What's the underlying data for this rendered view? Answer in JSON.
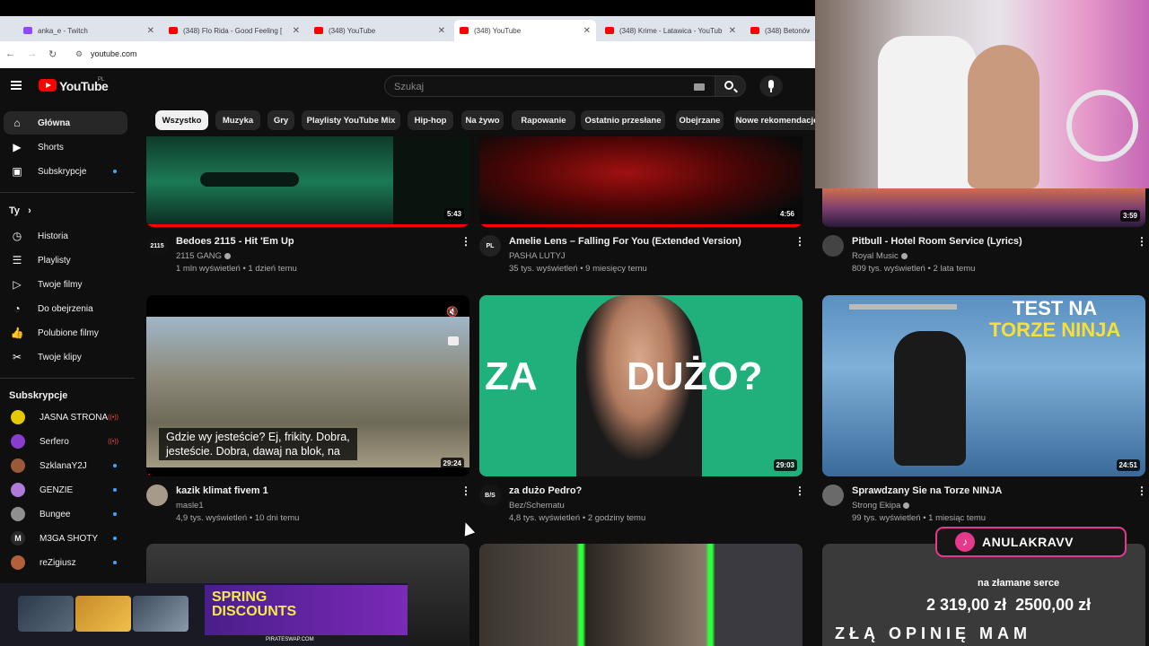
{
  "browser": {
    "tabs": [
      {
        "title": "anka_e - Twitch",
        "icon": "twitch-icon"
      },
      {
        "title": "(348) Flo Rida - Good Feeling [",
        "icon": "youtube-icon"
      },
      {
        "title": "(348) YouTube",
        "icon": "youtube-icon"
      },
      {
        "title": "(348) YouTube",
        "icon": "youtube-icon",
        "active": true
      },
      {
        "title": "(348) Krime - Latawica - YouTub",
        "icon": "youtube-icon"
      },
      {
        "title": "(348) Betonów",
        "icon": "youtube-icon"
      }
    ],
    "url": "youtube.com"
  },
  "header": {
    "logo_text": "YouTube",
    "country": "PL",
    "search_placeholder": "Szukaj"
  },
  "sidebar": {
    "main": [
      {
        "label": "Główna",
        "icon": "home-icon",
        "active": true
      },
      {
        "label": "Shorts",
        "icon": "shorts-icon"
      },
      {
        "label": "Subskrypcje",
        "icon": "subscriptions-icon",
        "dot": true
      }
    ],
    "you_heading": "Ty",
    "you": [
      {
        "label": "Historia",
        "icon": "history-icon"
      },
      {
        "label": "Playlisty",
        "icon": "playlist-icon"
      },
      {
        "label": "Twoje filmy",
        "icon": "your-videos-icon"
      },
      {
        "label": "Do obejrzenia",
        "icon": "watch-later-icon"
      },
      {
        "label": "Polubione filmy",
        "icon": "like-icon"
      },
      {
        "label": "Twoje klipy",
        "icon": "clips-icon"
      }
    ],
    "subs_heading": "Subskrypcje",
    "subs": [
      {
        "label": "JASNA STRONA",
        "color": "#e6c800",
        "live": true
      },
      {
        "label": "Serfero",
        "color": "#8a3ccf",
        "live": true
      },
      {
        "label": "SzklanaY2J",
        "color": "#9a5a3a",
        "dot": true
      },
      {
        "label": "GENZIE",
        "color": "#b07ad9",
        "dot": true
      },
      {
        "label": "Bungee",
        "color": "#8f8f8f",
        "dot": true
      },
      {
        "label": "M3GA SHOTY",
        "color": "#2a2a2a",
        "dot": true
      },
      {
        "label": "reZigiusz",
        "color": "#b0603a",
        "dot": true
      }
    ]
  },
  "chips": [
    "Wszystko",
    "Muzyka",
    "Gry",
    "Playlisty YouTube Mix",
    "Hip-hop",
    "Na żywo",
    "Rapowanie",
    "Ostatnio przesłane",
    "Obejrzane",
    "Nowe rekomendacje"
  ],
  "videos": [
    {
      "title": "Bedoes 2115 - Hit 'Em Up",
      "channel": "2115 GANG",
      "verified": true,
      "views": "1 mln wyświetleń",
      "age": "1 dzień temu",
      "duration": "5:43",
      "watched": 1.0,
      "avatar_text": "2115"
    },
    {
      "title": "Amelie Lens – Falling For You (Extended Version)",
      "channel": "PASHA LUTYJ",
      "verified": false,
      "views": "35 tys. wyświetleń",
      "age": "9 miesięcy temu",
      "duration": "4:56",
      "watched": 1.0,
      "avatar_text": "PL"
    },
    {
      "title": "Pitbull - Hotel Room Service (Lyrics)",
      "channel": "Royal Music",
      "verified": true,
      "views": "809 tys. wyświetleń",
      "age": "2 lata temu",
      "duration": "3:59",
      "watched": 0,
      "avatar_text": ""
    },
    {
      "title": "kazik klimat fivem 1",
      "channel": "masle1",
      "verified": false,
      "views": "4,9 tys. wyświetleń",
      "age": "10 dni temu",
      "duration": "29:24",
      "watched": 0,
      "avatar_text": "",
      "subtitle_line1": "Gdzie wy jesteście? Ej, frikity. Dobra,",
      "subtitle_line2": "jesteście. Dobra, dawaj na blok, na"
    },
    {
      "title": "za dużo Pedro?",
      "channel": "Bez/Schematu",
      "verified": false,
      "views": "4,8 tys. wyświetleń",
      "age": "2 godziny temu",
      "duration": "29:03",
      "watched": 0,
      "avatar_text": "B/S",
      "thumb_text_left": "ZA",
      "thumb_text_right": "DUŻO?"
    },
    {
      "title": "Sprawdzany Sie na Torze NINJA",
      "channel": "Strong Ekipa",
      "verified": true,
      "views": "99 tys. wyświetleń",
      "age": "1 miesiąc temu",
      "duration": "24:51",
      "watched": 0,
      "avatar_text": "",
      "thumb_text_line1": "TEST NA",
      "thumb_text_line2": "TORZE NINJA"
    }
  ],
  "overlays": {
    "tiktok_name": "ANULAKRAVV",
    "donation_label": "na złamane serce",
    "donation_amount": "2 319,00 zł",
    "donation_goal": "2500,00 zł",
    "donation_big": "ZŁĄ OPINIĘ MAM",
    "ad_title_line1": "SPRING",
    "ad_title_line2": "DISCOUNTS",
    "ad_site": "PIRATESWAP.COM"
  }
}
